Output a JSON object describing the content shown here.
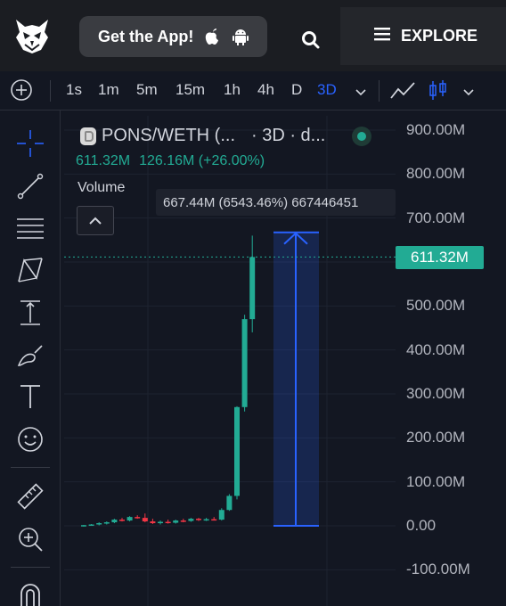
{
  "header": {
    "get_app_label": "Get the App!",
    "explore_label": "EXPLORE",
    "logo_icon": "owl-logo-icon",
    "apple_icon": "apple-icon",
    "android_icon": "android-icon",
    "search_icon": "search-icon",
    "menu_icon": "menu-icon"
  },
  "toolbar": {
    "timeframes": [
      "1s",
      "1m",
      "5m",
      "15m",
      "1h",
      "4h",
      "D",
      "3D"
    ],
    "active_timeframe": "3D"
  },
  "legend": {
    "pair": "PONS/WETH (...",
    "interval_source": "· 3D · d...",
    "price": "611.32M",
    "change": "126.16M (+26.00%)",
    "volume_label": "Volume"
  },
  "measure": {
    "tooltip": "667.44M (6543.46%) 667446451"
  },
  "price_scale": {
    "labels": [
      "900.00M",
      "800.00M",
      "700.00M",
      "500.00M",
      "400.00M",
      "300.00M",
      "200.00M",
      "100.00M",
      "0.00",
      "-100.00M"
    ],
    "current_price": "611.32M"
  },
  "colors": {
    "up": "#22ab94",
    "down": "#f23645",
    "accent": "#2962ff",
    "background": "#131722"
  },
  "chart_data": {
    "type": "candlestick",
    "ylim": [
      -100000000,
      900000000
    ],
    "current_price": 611320000,
    "candles": [
      {
        "o": 0,
        "h": 2000000,
        "l": -2000000,
        "c": 1500000
      },
      {
        "o": 1500000,
        "h": 4000000,
        "l": 0,
        "c": 3000000
      },
      {
        "o": 3000000,
        "h": 8000000,
        "l": 1000000,
        "c": 6000000
      },
      {
        "o": 6000000,
        "h": 10000000,
        "l": 3000000,
        "c": 8000000
      },
      {
        "o": 8000000,
        "h": 16000000,
        "l": 6000000,
        "c": 14000000
      },
      {
        "o": 14000000,
        "h": 18000000,
        "l": 10000000,
        "c": 12000000
      },
      {
        "o": 12000000,
        "h": 22000000,
        "l": 10000000,
        "c": 20000000
      },
      {
        "o": 20000000,
        "h": 24000000,
        "l": 16000000,
        "c": 18000000
      },
      {
        "o": 18000000,
        "h": 28000000,
        "l": 8000000,
        "c": 10000000
      },
      {
        "o": 10000000,
        "h": 16000000,
        "l": 4000000,
        "c": 6000000
      },
      {
        "o": 6000000,
        "h": 12000000,
        "l": 3000000,
        "c": 9000000
      },
      {
        "o": 9000000,
        "h": 14000000,
        "l": 5000000,
        "c": 7000000
      },
      {
        "o": 7000000,
        "h": 14000000,
        "l": 5000000,
        "c": 12000000
      },
      {
        "o": 12000000,
        "h": 16000000,
        "l": 8000000,
        "c": 11000000
      },
      {
        "o": 11000000,
        "h": 18000000,
        "l": 9000000,
        "c": 16000000
      },
      {
        "o": 16000000,
        "h": 18000000,
        "l": 11000000,
        "c": 13000000
      },
      {
        "o": 13000000,
        "h": 18000000,
        "l": 11000000,
        "c": 15000000
      },
      {
        "o": 15000000,
        "h": 20000000,
        "l": 12000000,
        "c": 14000000
      },
      {
        "o": 14000000,
        "h": 40000000,
        "l": 12000000,
        "c": 36000000
      },
      {
        "o": 36000000,
        "h": 72000000,
        "l": 34000000,
        "c": 68000000
      },
      {
        "o": 68000000,
        "h": 272000000,
        "l": 60000000,
        "c": 270000000
      },
      {
        "o": 270000000,
        "h": 480000000,
        "l": 260000000,
        "c": 470000000
      },
      {
        "o": 470000000,
        "h": 660000000,
        "l": 440000000,
        "c": 611320000
      }
    ],
    "measure_range": [
      0,
      667440000
    ]
  }
}
